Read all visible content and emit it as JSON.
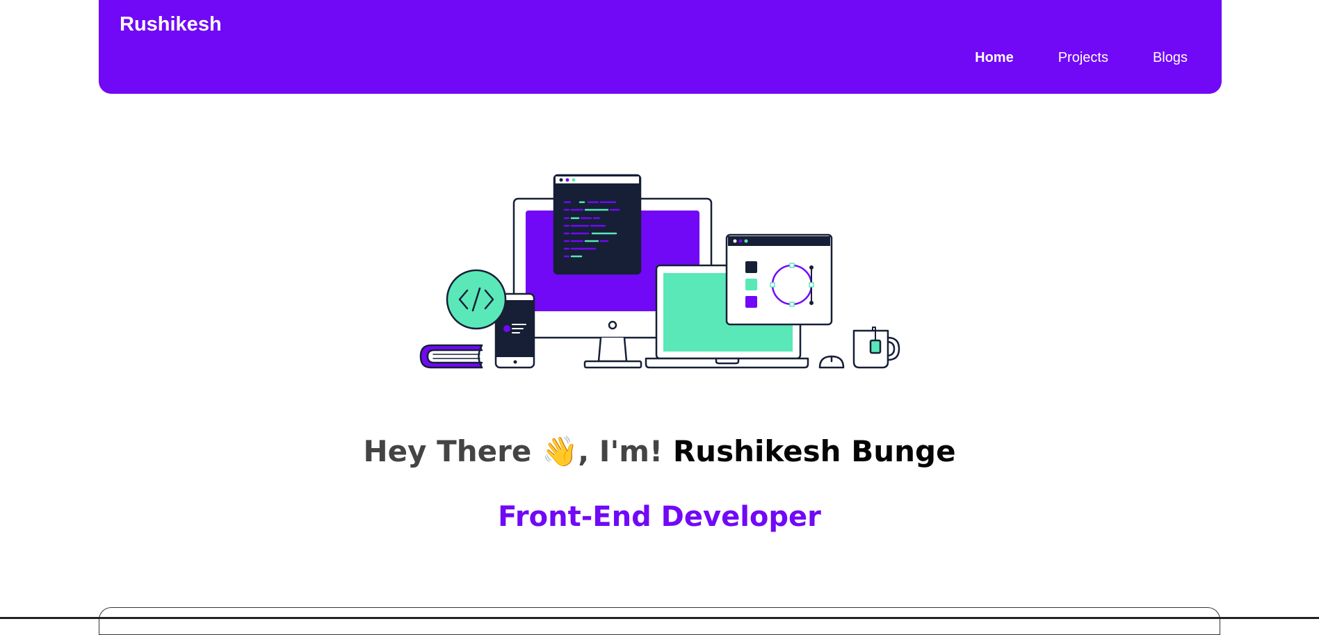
{
  "navbar": {
    "brand": "Rushikesh",
    "links": [
      {
        "label": "Home",
        "active": true
      },
      {
        "label": "Projects",
        "active": false
      },
      {
        "label": "Blogs",
        "active": false
      }
    ],
    "background_color": "#7109f6"
  },
  "hero": {
    "greeting_prefix": "Hey There",
    "wave_emoji": "👋",
    "greeting_suffix": ", I'm!",
    "name": "Rushikesh Bunge",
    "role": "Front-End Developer",
    "illustration": "developer-workspace-illustration",
    "accent_color": "#7109f6",
    "mint_color": "#5ae8b9",
    "dark_color": "#161f36"
  }
}
